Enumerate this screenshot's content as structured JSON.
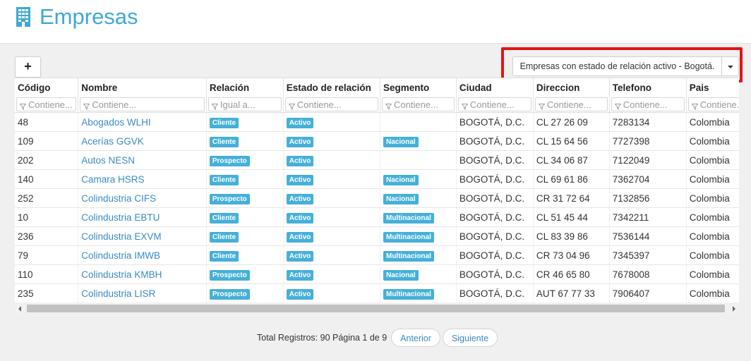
{
  "page": {
    "title": "Empresas",
    "add_label": "+",
    "filter_preset": "Empresas con estado de relación activo - Bogotá."
  },
  "accent_color": "#3fa8d8",
  "highlight_color": "#e01515",
  "columns": [
    {
      "label": "Código",
      "placeholder": "Contiene..."
    },
    {
      "label": "Nombre",
      "placeholder": "Contiene..."
    },
    {
      "label": "Relación",
      "placeholder": "Igual a..."
    },
    {
      "label": "Estado de relación",
      "placeholder": "Contiene..."
    },
    {
      "label": "Segmento",
      "placeholder": "Contiene..."
    },
    {
      "label": "Ciudad",
      "placeholder": "Contiene..."
    },
    {
      "label": "Direccion",
      "placeholder": "Contiene..."
    },
    {
      "label": "Telefono",
      "placeholder": "Contiene..."
    },
    {
      "label": "Pais",
      "placeholder": "Contiene..."
    }
  ],
  "rows": [
    {
      "codigo": "48",
      "nombre": "Abogados WLHI",
      "relacion": "Cliente",
      "estado": "Activo",
      "segmento": "",
      "ciudad": "BOGOTÁ, D.C.",
      "direccion": "CL 27 26 09",
      "telefono": "7283134",
      "pais": "Colombia"
    },
    {
      "codigo": "109",
      "nombre": "Acerías GGVK",
      "relacion": "Cliente",
      "estado": "Activo",
      "segmento": "Nacional",
      "ciudad": "BOGOTÁ, D.C.",
      "direccion": "CL 15 64 56",
      "telefono": "7727398",
      "pais": "Colombia"
    },
    {
      "codigo": "202",
      "nombre": "Autos NESN",
      "relacion": "Prospecto",
      "estado": "Activo",
      "segmento": "",
      "ciudad": "BOGOTÁ, D.C.",
      "direccion": "CL 34 06 87",
      "telefono": "7122049",
      "pais": "Colombia"
    },
    {
      "codigo": "140",
      "nombre": "Camara HSRS",
      "relacion": "Cliente",
      "estado": "Activo",
      "segmento": "Nacional",
      "ciudad": "BOGOTÁ, D.C.",
      "direccion": "CL 69 61 86",
      "telefono": "7362704",
      "pais": "Colombia"
    },
    {
      "codigo": "252",
      "nombre": "Colindustria CIFS",
      "relacion": "Prospecto",
      "estado": "Activo",
      "segmento": "Nacional",
      "ciudad": "BOGOTÁ, D.C.",
      "direccion": "CR 31 72 64",
      "telefono": "7132856",
      "pais": "Colombia"
    },
    {
      "codigo": "10",
      "nombre": "Colindustria EBTU",
      "relacion": "Cliente",
      "estado": "Activo",
      "segmento": "Multinacional",
      "ciudad": "BOGOTÁ, D.C.",
      "direccion": "CL 51 45 44",
      "telefono": "7342211",
      "pais": "Colombia"
    },
    {
      "codigo": "236",
      "nombre": "Colindustria EXVM",
      "relacion": "Cliente",
      "estado": "Activo",
      "segmento": "Multinacional",
      "ciudad": "BOGOTÁ, D.C.",
      "direccion": "CL 83 39 86",
      "telefono": "7536144",
      "pais": "Colombia"
    },
    {
      "codigo": "79",
      "nombre": "Colindustria IMWB",
      "relacion": "Cliente",
      "estado": "Activo",
      "segmento": "Multinacional",
      "ciudad": "BOGOTÁ, D.C.",
      "direccion": "CR 73 04 96",
      "telefono": "7345397",
      "pais": "Colombia"
    },
    {
      "codigo": "110",
      "nombre": "Colindustria KMBH",
      "relacion": "Prospecto",
      "estado": "Activo",
      "segmento": "Nacional",
      "ciudad": "BOGOTÁ, D.C.",
      "direccion": "CR 46 65 80",
      "telefono": "7678008",
      "pais": "Colombia"
    },
    {
      "codigo": "235",
      "nombre": "Colindustria LISR",
      "relacion": "Prospecto",
      "estado": "Activo",
      "segmento": "Multinacional",
      "ciudad": "BOGOTÁ, D.C.",
      "direccion": "AUT 67 77 33",
      "telefono": "7906407",
      "pais": "Colombia"
    }
  ],
  "pager": {
    "info": "Total Registros: 90 Página 1 de 9",
    "prev_label": "Anterior",
    "next_label": "Siguiente"
  }
}
